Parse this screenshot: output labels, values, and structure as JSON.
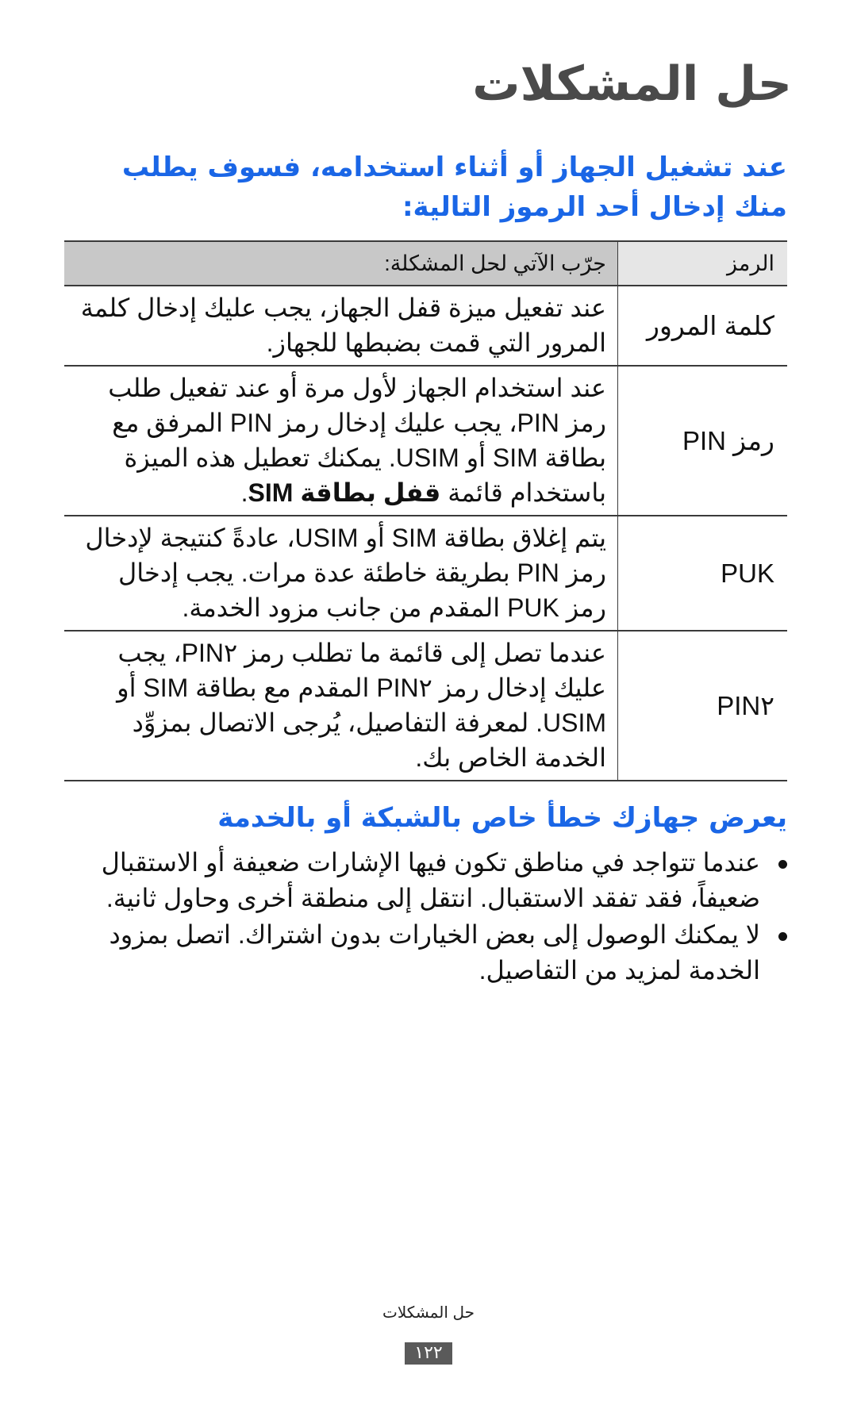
{
  "page": {
    "title": "حل المشكلات",
    "intro": "عند تشغيل الجهاز أو أثناء استخدامه، فسوف يطلب منك إدخال أحد الرموز التالية:"
  },
  "table": {
    "headers": {
      "code": "الرمز",
      "solution": "جرّب الآتي لحل المشكلة:"
    },
    "rows": [
      {
        "code": "كلمة المرور",
        "desc": "عند تفعيل ميزة قفل الجهاز، يجب عليك إدخال كلمة المرور التي قمت بضبطها للجهاز.",
        "desc_bold": ""
      },
      {
        "code": "رمز PIN",
        "desc": "عند استخدام الجهاز لأول مرة أو عند تفعيل طلب رمز PIN، يجب عليك إدخال رمز PIN المرفق مع بطاقة SIM أو USIM. يمكنك تعطيل هذه الميزة باستخدام قائمة ",
        "desc_bold": "قفل بطاقة SIM",
        "desc_tail": "."
      },
      {
        "code": "PUK",
        "desc": "يتم إغلاق بطاقة SIM أو USIM، عادةً كنتيجة لإدخال رمز PIN بطريقة خاطئة عدة مرات. يجب إدخال رمز PUK المقدم من جانب مزود الخدمة.",
        "desc_bold": ""
      },
      {
        "code": "PIN٢",
        "desc": "عندما تصل إلى قائمة ما تطلب رمز PIN٢، يجب عليك إدخال رمز PIN٢ المقدم مع بطاقة SIM أو USIM. لمعرفة التفاصيل، يُرجى الاتصال بمزوِّد الخدمة الخاص بك.",
        "desc_bold": ""
      }
    ]
  },
  "section": {
    "heading": "يعرض جهازك خطأ خاص بالشبكة أو بالخدمة",
    "bullets": [
      "عندما تتواجد في مناطق تكون فيها الإشارات ضعيفة أو الاستقبال ضعيفاً، فقد تفقد الاستقبال. انتقل إلى منطقة أخرى وحاول ثانية.",
      "لا يمكنك الوصول إلى بعض الخيارات بدون اشتراك. اتصل بمزود الخدمة لمزيد من التفاصيل."
    ]
  },
  "footer": {
    "label": "حل المشكلات",
    "page_number": "١٢٢"
  }
}
